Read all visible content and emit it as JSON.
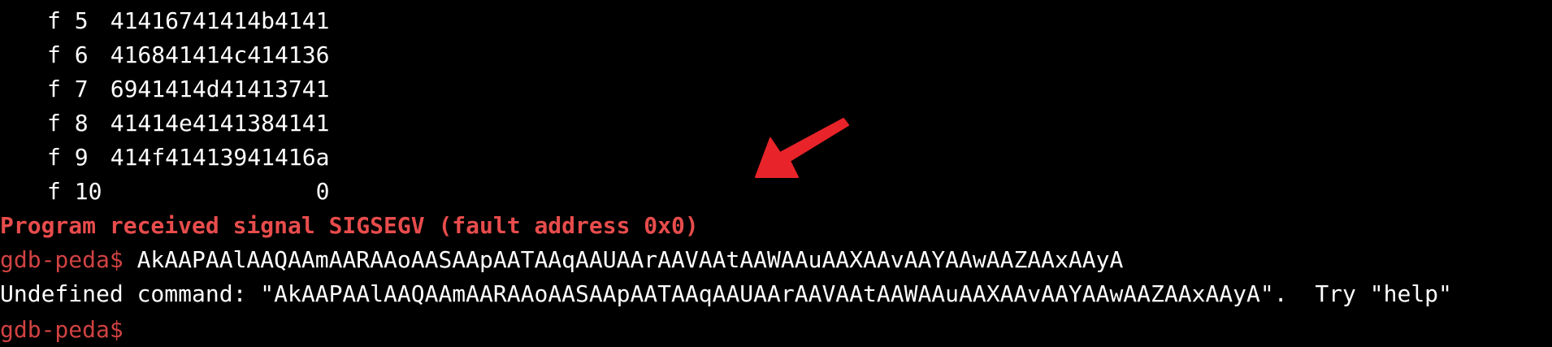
{
  "frames": [
    {
      "label": "f",
      "num": "5",
      "value": "41416741414b4141"
    },
    {
      "label": "f",
      "num": "6",
      "value": "416841414c414136"
    },
    {
      "label": "f",
      "num": "7",
      "value": "6941414d41413741"
    },
    {
      "label": "f",
      "num": "8",
      "value": "41414e4141384141"
    },
    {
      "label": "f",
      "num": "9",
      "value": "414f41413941416a"
    },
    {
      "label": "f",
      "num": "10",
      "value": "               0"
    }
  ],
  "signal_message": "Program received signal SIGSEGV (fault address 0x0)",
  "prompt": "gdb-peda$",
  "command_input": " AkAAPAAlAAQAAmAARAAoAASAApAATAAqAAUAArAAVAAtAAWAAuAAXAAvAAYAAwAAZAAxAAyA",
  "error_output": "Undefined command: \"AkAAPAAlAAQAAmAARAAoAASAApAATAAqAAUAArAAVAAtAAWAAuAAXAAvAAYAAwAAZAAxAAyA\".  Try \"help\"",
  "next_prompt": "gdb-peda$",
  "colors": {
    "background": "#000000",
    "text": "#ffffff",
    "signal": "#e84c4c",
    "prompt": "#d14242",
    "arrow": "#e8242a"
  },
  "annotation_icon": "red-arrow-icon"
}
